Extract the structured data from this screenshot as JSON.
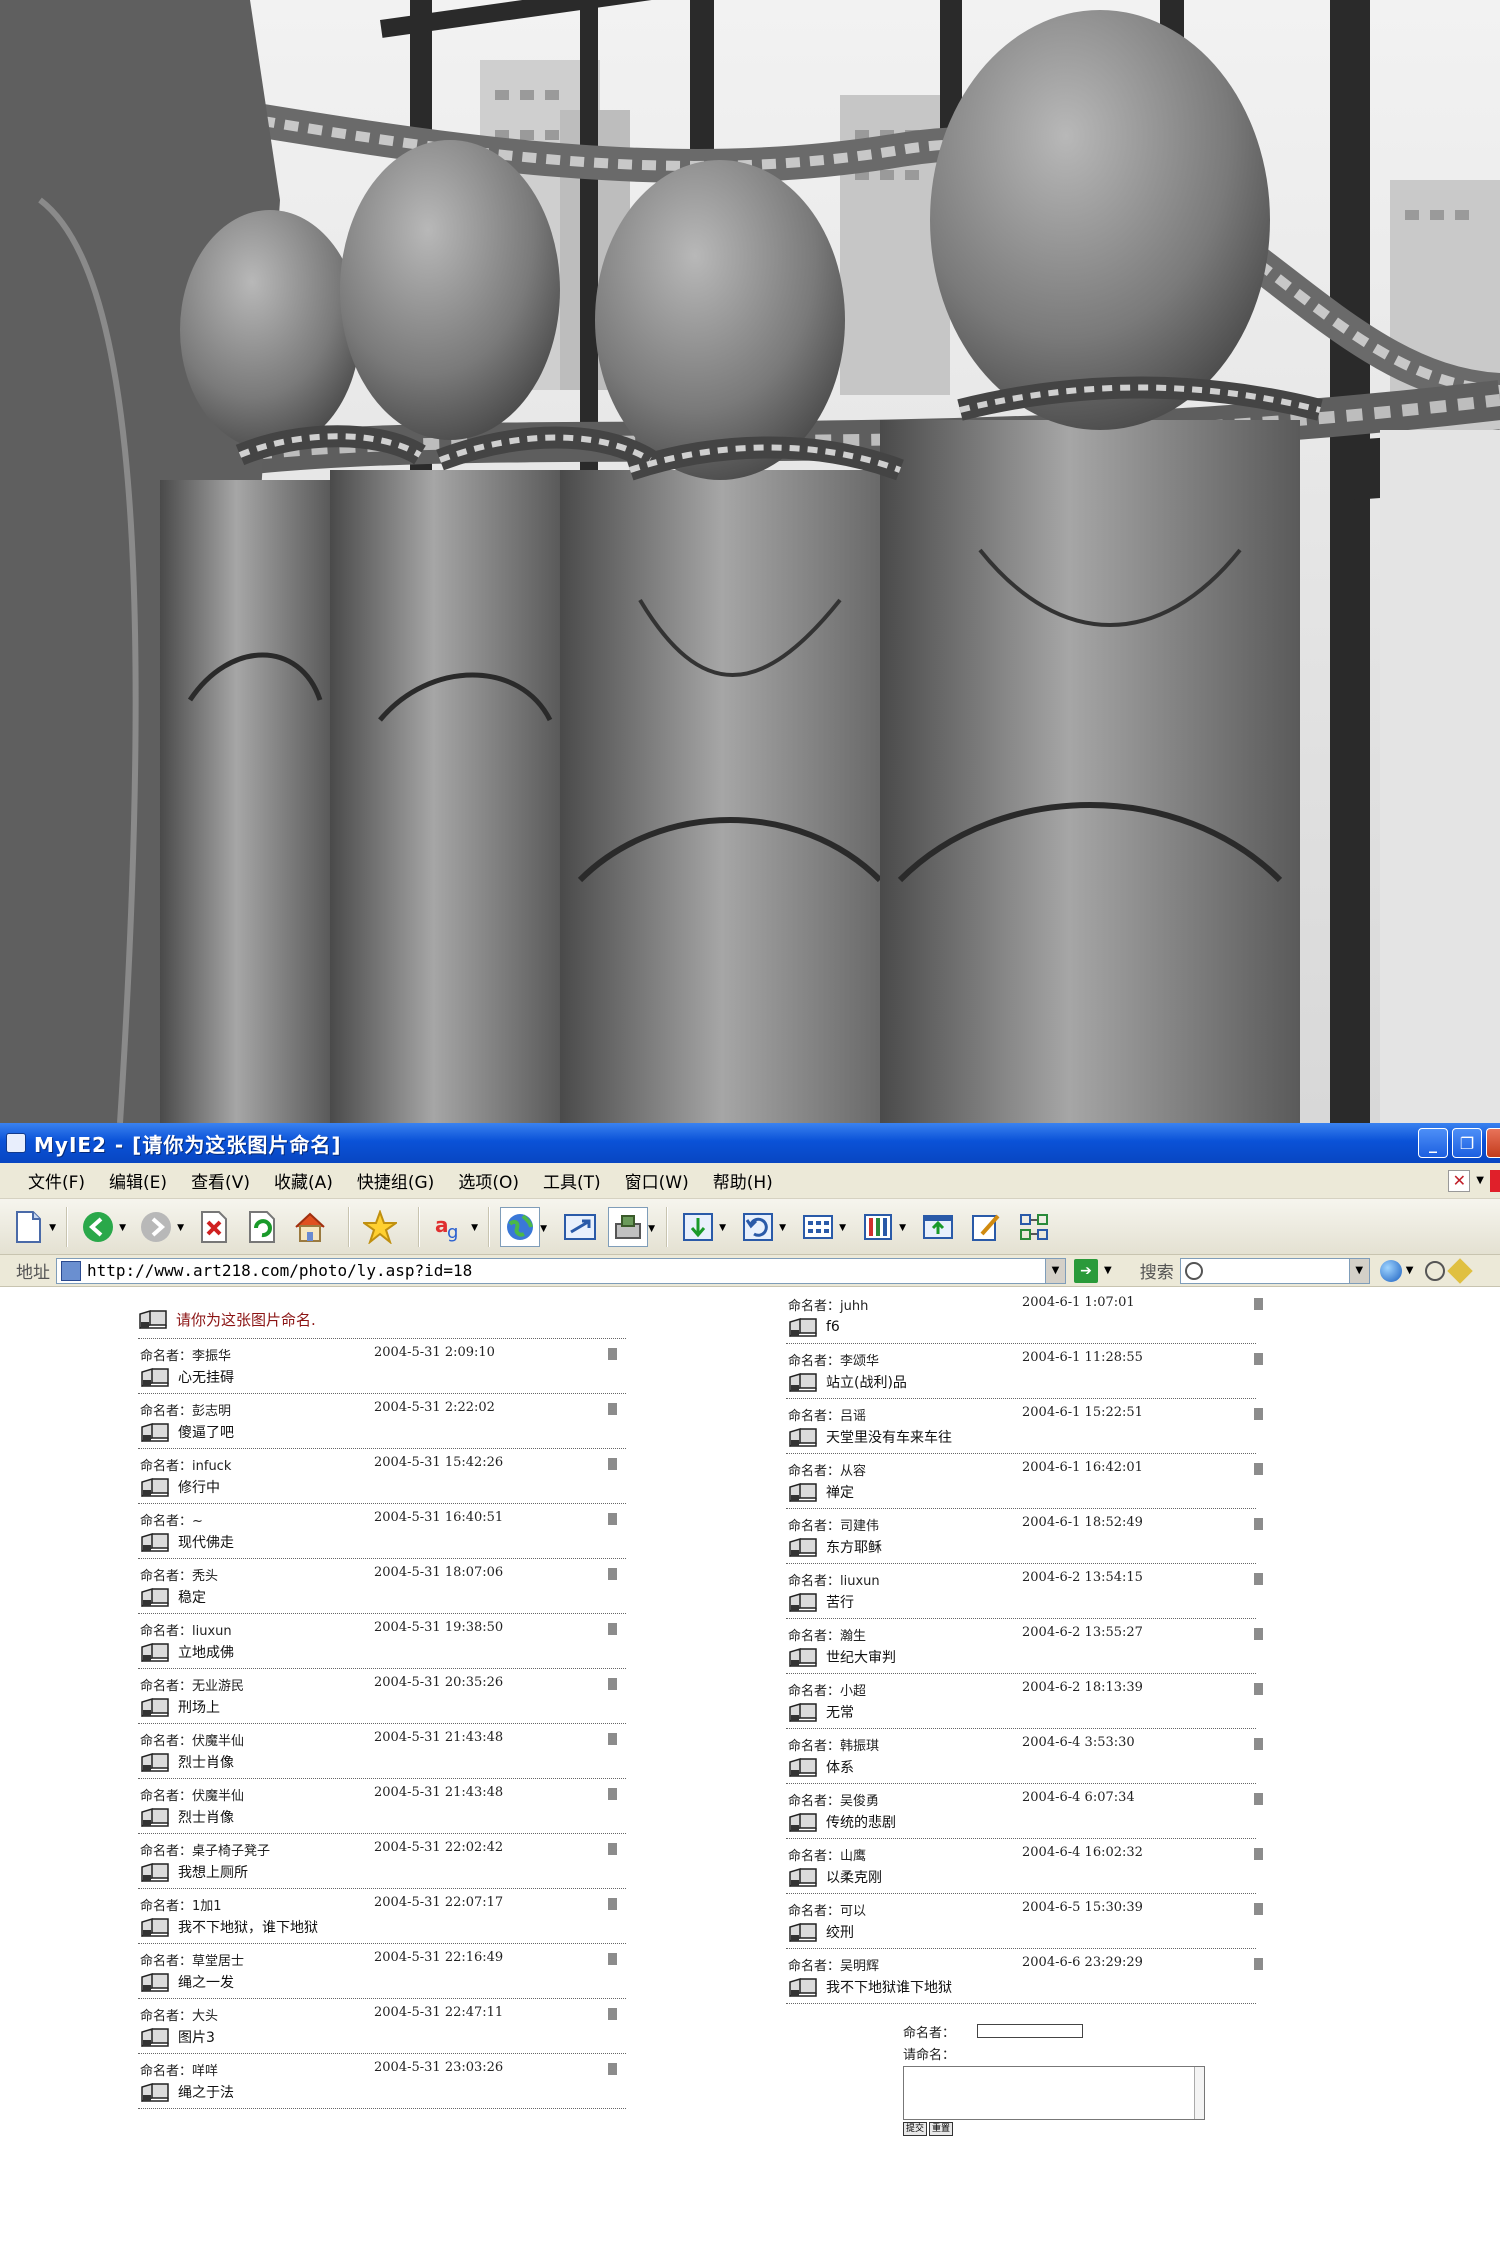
{
  "browser": {
    "title": "MyIE2 - [请你为这张图片命名]",
    "menu": [
      "文件(F)",
      "编辑(E)",
      "查看(V)",
      "收藏(A)",
      "快捷组(G)",
      "选项(O)",
      "工具(T)",
      "窗口(W)",
      "帮助(H)"
    ],
    "address_label": "地址",
    "url": "http://www.art218.com/photo/ly.asp?id=18",
    "search_label": "搜索"
  },
  "page": {
    "heading": "请你为这张图片命名.",
    "left_entries": [
      {
        "author": "李振华",
        "date": "2004-5-31 2:09:10",
        "name": "心无挂碍"
      },
      {
        "author": "彭志明",
        "date": "2004-5-31 2:22:02",
        "name": "傻逼了吧"
      },
      {
        "author": "infuck",
        "date": "2004-5-31 15:42:26",
        "name": "修行中"
      },
      {
        "author": "~",
        "date": "2004-5-31 16:40:51",
        "name": "现代佛走"
      },
      {
        "author": "秃头",
        "date": "2004-5-31 18:07:06",
        "name": "稳定"
      },
      {
        "author": "liuxun",
        "date": "2004-5-31 19:38:50",
        "name": "立地成佛"
      },
      {
        "author": "无业游民",
        "date": "2004-5-31 20:35:26",
        "name": "刑场上"
      },
      {
        "author": "伏魔半仙",
        "date": "2004-5-31 21:43:48",
        "name": "烈士肖像"
      },
      {
        "author": "伏魔半仙",
        "date": "2004-5-31 21:43:48",
        "name": "烈士肖像"
      },
      {
        "author": "桌子椅子凳子",
        "date": "2004-5-31 22:02:42",
        "name": "我想上厕所"
      },
      {
        "author": "1加1",
        "date": "2004-5-31 22:07:17",
        "name": "我不下地狱，谁下地狱"
      },
      {
        "author": "草堂居士",
        "date": "2004-5-31 22:16:49",
        "name": "绳之一发"
      },
      {
        "author": "大头",
        "date": "2004-5-31 22:47:11",
        "name": "图片3"
      },
      {
        "author": "咩咩",
        "date": "2004-5-31 23:03:26",
        "name": "绳之于法"
      }
    ],
    "right_entries": [
      {
        "author": "juhh",
        "date": "2004-6-1 1:07:01",
        "name": "f6"
      },
      {
        "author": "李颂华",
        "date": "2004-6-1 11:28:55",
        "name": "站立(战利)品"
      },
      {
        "author": "吕谣",
        "date": "2004-6-1 15:22:51",
        "name": "天堂里没有车来车往"
      },
      {
        "author": "从容",
        "date": "2004-6-1 16:42:01",
        "name": "禅定"
      },
      {
        "author": "司建伟",
        "date": "2004-6-1 18:52:49",
        "name": "东方耶稣"
      },
      {
        "author": "liuxun",
        "date": "2004-6-2 13:54:15",
        "name": "苦行"
      },
      {
        "author": "瀚生",
        "date": "2004-6-2 13:55:27",
        "name": "世纪大审判"
      },
      {
        "author": "小超",
        "date": "2004-6-2 18:13:39",
        "name": "无常"
      },
      {
        "author": "韩振琪",
        "date": "2004-6-4 3:53:30",
        "name": "体系"
      },
      {
        "author": "吴俊勇",
        "date": "2004-6-4 6:07:34",
        "name": "传统的悲剧"
      },
      {
        "author": "山鹰",
        "date": "2004-6-4 16:02:32",
        "name": "以柔克刚"
      },
      {
        "author": "可以",
        "date": "2004-6-5 15:30:39",
        "name": "绞刑"
      },
      {
        "author": "吴明辉",
        "date": "2004-6-6 23:29:29",
        "name": "我不下地狱谁下地狱"
      }
    ],
    "author_label": "命名者：",
    "form": {
      "name_label": "命名者：",
      "comment_label": "请命名：",
      "submit": "提交",
      "reset": "重置"
    }
  }
}
